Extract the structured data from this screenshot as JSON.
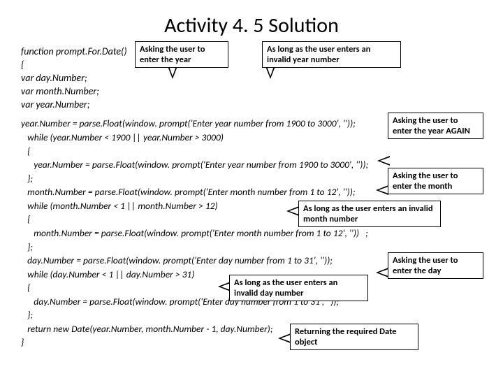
{
  "title": "Activity 4. 5 Solution",
  "decl": {
    "l1": "function prompt.For.Date()",
    "l2": "{",
    "l3": "var day.Number;",
    "l4": "var month.Number;",
    "l5": "var year.Number;"
  },
  "code": "year.Number = parse.Float(window. prompt('Enter year number from 1900 to 3000', ''));\n   while (year.Number < 1900 || year.Number > 3000)\n   {\n      year.Number = parse.Float(window. prompt('Enter year number from 1900 to 3000', ''));\n   };\n   month.Number = parse.Float(window. prompt('Enter month number from 1 to 12', ''));\n   while (month.Number < 1 || month.Number > 12)\n   {\n      month.Number = parse.Float(window. prompt('Enter month number from 1 to 12', ''))   ;\n   };\n   day.Number = parse.Float(window. prompt('Enter day number from 1 to 31', ''));\n   while (day.Number < 1 || day.Number > 31)\n   {\n      day.Number = parse.Float(window. prompt('Enter day number from 1 to 31', ''));\n   };\n   return new Date(year.Number, month.Number - 1, day.Number);\n}",
  "callouts": {
    "c1": "Asking the user to enter the year",
    "c2": "As long as the user enters an invalid year number",
    "c3": "Asking the user to enter the year AGAIN",
    "c4": "Asking the user to enter the month",
    "c5": "As long as the user enters an invalid month number",
    "c6": "Asking the user to enter the day",
    "c7": "As long as the user enters an invalid day number",
    "c8": "Returning the required Date object"
  }
}
